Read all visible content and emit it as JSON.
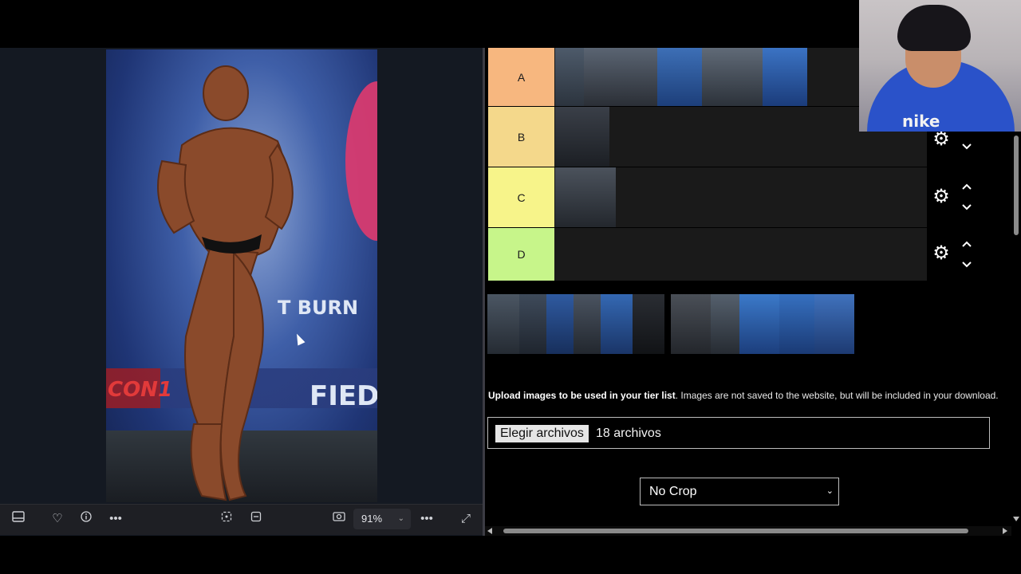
{
  "viewer": {
    "zoom": "91%",
    "photo_texts": {
      "burn": "T BURN",
      "brand": "FIED",
      "stage_left": "CON1"
    },
    "icons": [
      "filmstrip-icon",
      "heart-icon",
      "info-icon",
      "more-icon",
      "crop-icon",
      "select-icon",
      "screenshot-icon",
      "zoom-chevron-icon",
      "more-icon",
      "expand-icon"
    ]
  },
  "tiers": [
    {
      "label": "A",
      "color": "#f7b77f",
      "thumbs": 5
    },
    {
      "label": "B",
      "color": "#f4d88b",
      "thumbs": 1
    },
    {
      "label": "C",
      "color": "#f7f48a",
      "thumbs": 1
    },
    {
      "label": "D",
      "color": "#c7f58a",
      "thumbs": 0
    }
  ],
  "pool_thumbs": 12,
  "upload": {
    "bold": "Upload images to be used in your tier list",
    "rest": ". Images are not saved to the website, but will be included in your download."
  },
  "file_input": {
    "button": "Elegir archivos",
    "count": "18 archivos"
  },
  "crop": {
    "value": "No Crop"
  },
  "webcam": {
    "shirt_text": "nike"
  },
  "colors": {
    "viewer_bg": "#141922",
    "tier_bg": "#1a1a1a",
    "hoodie": "#2a52c9"
  }
}
